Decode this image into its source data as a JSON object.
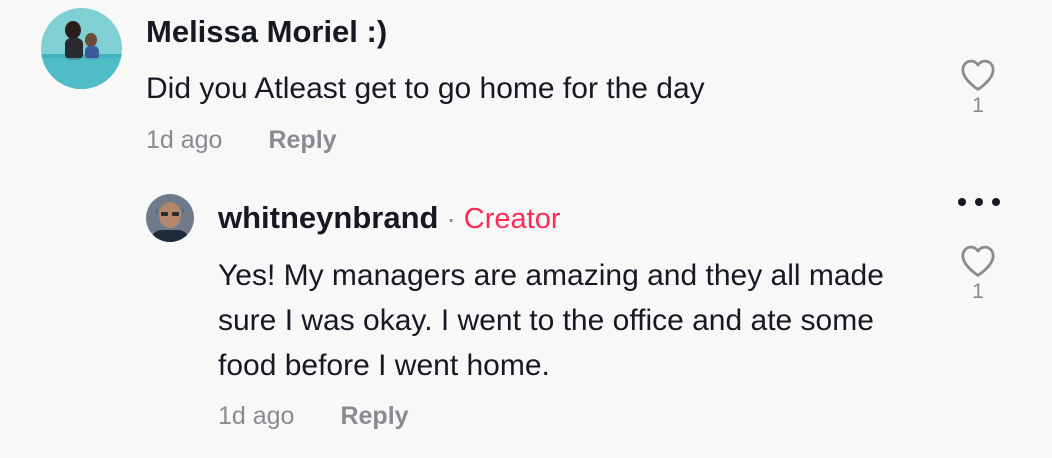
{
  "comments": [
    {
      "username": "Melissa Moriel :)",
      "text": "Did you Atleast get to go home for the day",
      "time": "1d ago",
      "reply_label": "Reply",
      "likes": "1"
    }
  ],
  "reply": {
    "username": "whitneynbrand",
    "separator": "·",
    "badge": "Creator",
    "text": "Yes! My managers are amazing and they all made sure I was okay. I went to the office and ate some food before I went home.",
    "time": "1d ago",
    "reply_label": "Reply",
    "likes": "1"
  },
  "colors": {
    "background": "#f8f8f8",
    "text": "#161823",
    "muted": "#8a8b91",
    "creator_badge": "#fe2c55"
  },
  "icons": {
    "like": "heart-outline-icon",
    "more": "more-horizontal-icon"
  }
}
